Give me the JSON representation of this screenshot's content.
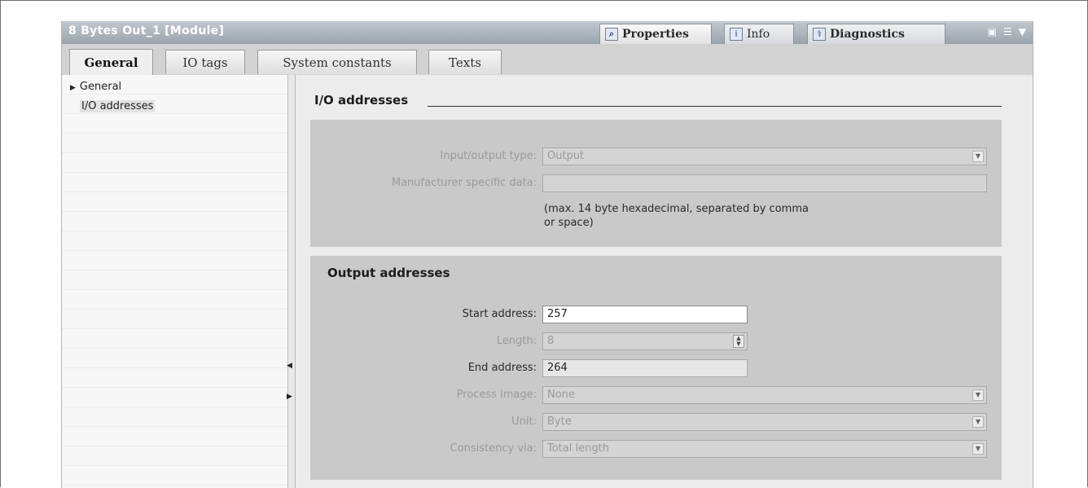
{
  "window": {
    "title": "8  Bytes Out_1 [Module]"
  },
  "inspector_tabs": [
    {
      "label": "Properties",
      "icon": "properties-icon"
    },
    {
      "label": "Info",
      "icon": "info-icon"
    },
    {
      "label": "Diagnostics",
      "icon": "diagnostics-icon"
    }
  ],
  "tabs": [
    "General",
    "IO tags",
    "System constants",
    "Texts"
  ],
  "nav": {
    "items": [
      "General",
      "I/O addresses"
    ]
  },
  "io": {
    "heading": "I/O addresses",
    "type_label": "Input/output type:",
    "type_value": "Output",
    "mfr_label": "Manufacturer specific data:",
    "mfr_value": "",
    "note_line1": "(max. 14 byte hexadecimal, separated by comma",
    "note_line2": "or space)"
  },
  "out": {
    "title": "Output addresses",
    "start_label": "Start address:",
    "start_value": "257",
    "length_label": "Length:",
    "length_value": "8",
    "end_label": "End address:",
    "end_value": "264",
    "pi_label": "Process image:",
    "pi_value": "None",
    "unit_label": "Unit:",
    "unit_value": "Byte",
    "cons_label": "Consistency via:",
    "cons_value": "Total length"
  }
}
